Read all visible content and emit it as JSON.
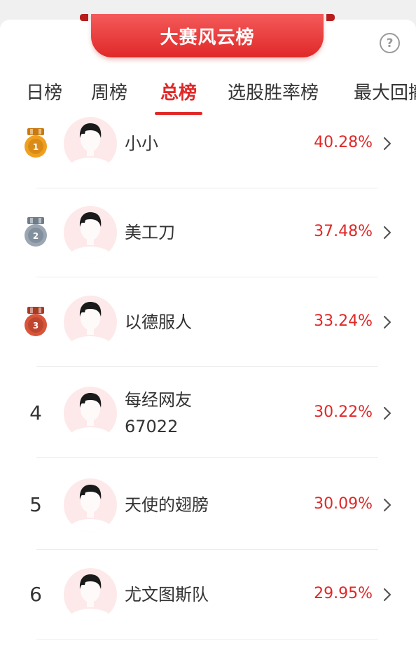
{
  "header": {
    "title": "大赛风云榜",
    "help_icon": "question-circle-icon",
    "help_symbol": "?"
  },
  "tabs": [
    {
      "label": "日榜",
      "active": false
    },
    {
      "label": "周榜",
      "active": false
    },
    {
      "label": "总榜",
      "active": true
    },
    {
      "label": "选股胜率榜",
      "active": false
    },
    {
      "label": "最大回撤",
      "active": false
    }
  ],
  "ranking": [
    {
      "rank": "1",
      "rank_style": "gold-medal",
      "name_lines": [
        "小小"
      ],
      "percent": "40.28%"
    },
    {
      "rank": "2",
      "rank_style": "silver-medal",
      "name_lines": [
        "美工刀"
      ],
      "percent": "37.48%"
    },
    {
      "rank": "3",
      "rank_style": "bronze-medal",
      "name_lines": [
        "以德服人"
      ],
      "percent": "33.24%"
    },
    {
      "rank": "4",
      "rank_style": "number",
      "name_lines": [
        "每经网友",
        "67022"
      ],
      "percent": "30.22%"
    },
    {
      "rank": "5",
      "rank_style": "number",
      "name_lines": [
        "天使的翅膀"
      ],
      "percent": "30.09%"
    },
    {
      "rank": "6",
      "rank_style": "number",
      "name_lines": [
        "尤文图斯队"
      ],
      "percent": "29.95%"
    }
  ],
  "colors": {
    "accent": "#e02828",
    "gold": "#f0a020",
    "silver": "#9aa6b4",
    "bronze": "#d9553a",
    "avatar_bg": "#fde9ea"
  }
}
